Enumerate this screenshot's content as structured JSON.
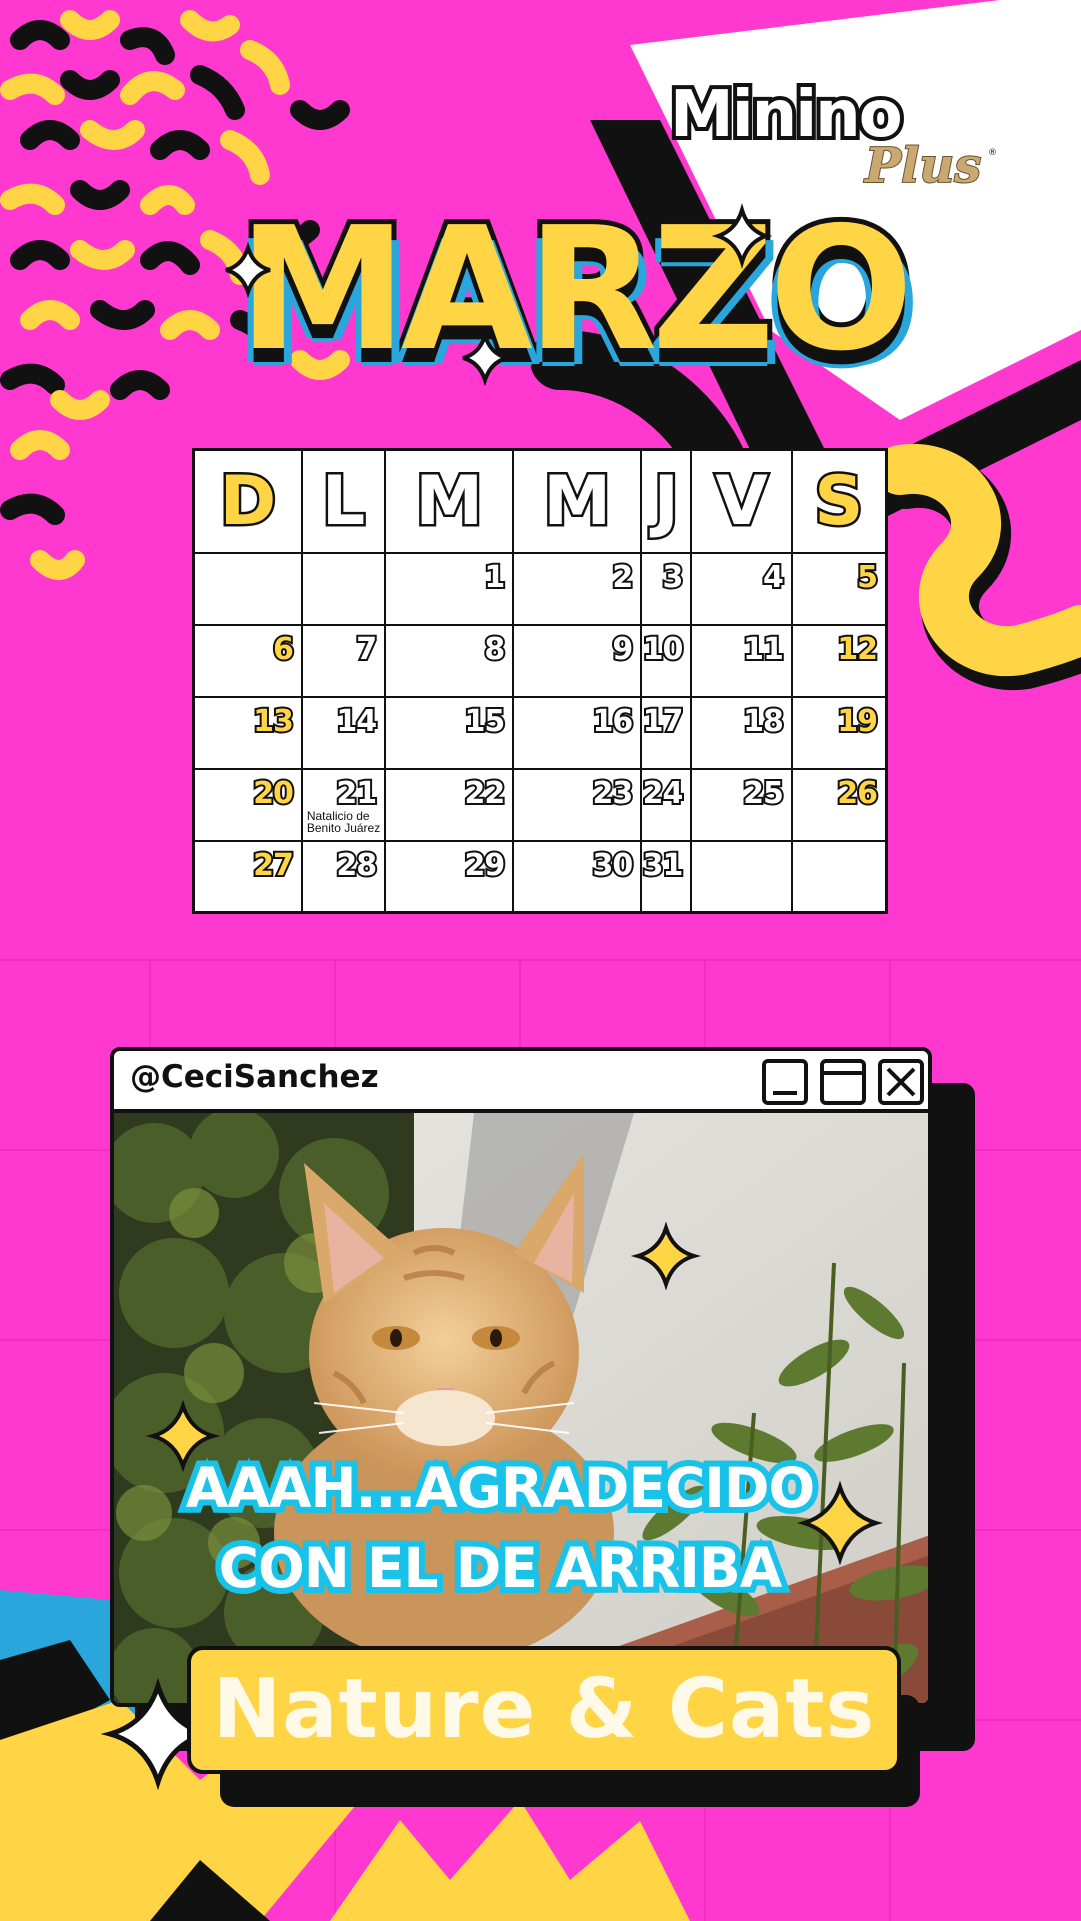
{
  "brand": {
    "name": "Minino",
    "sub": "Plus",
    "registered": "®"
  },
  "month": "MARZO",
  "calendar": {
    "weekdays": [
      "D",
      "L",
      "M",
      "M",
      "J",
      "V",
      "S"
    ],
    "weeks": [
      [
        "",
        "",
        "1",
        "2",
        "3",
        "4",
        "5"
      ],
      [
        "6",
        "7",
        "8",
        "9",
        "10",
        "11",
        "12"
      ],
      [
        "13",
        "14",
        "15",
        "16",
        "17",
        "18",
        "19"
      ],
      [
        "20",
        "21",
        "22",
        "23",
        "24",
        "25",
        "26"
      ],
      [
        "27",
        "28",
        "29",
        "30",
        "31",
        "",
        ""
      ]
    ],
    "holiday": {
      "day": "21",
      "note": "Natalicio de Benito Juárez"
    }
  },
  "window": {
    "author": "@CeciSanchez",
    "caption_line1": "AAAH...AGRADECIDO",
    "caption_line2": "CON EL DE ARRIBA"
  },
  "banner": "Nature & Cats",
  "colors": {
    "background": "#ff38cf",
    "yellow": "#ffd546",
    "blue": "#29a6dc",
    "cyan": "#19c2e8",
    "black": "#111111"
  }
}
